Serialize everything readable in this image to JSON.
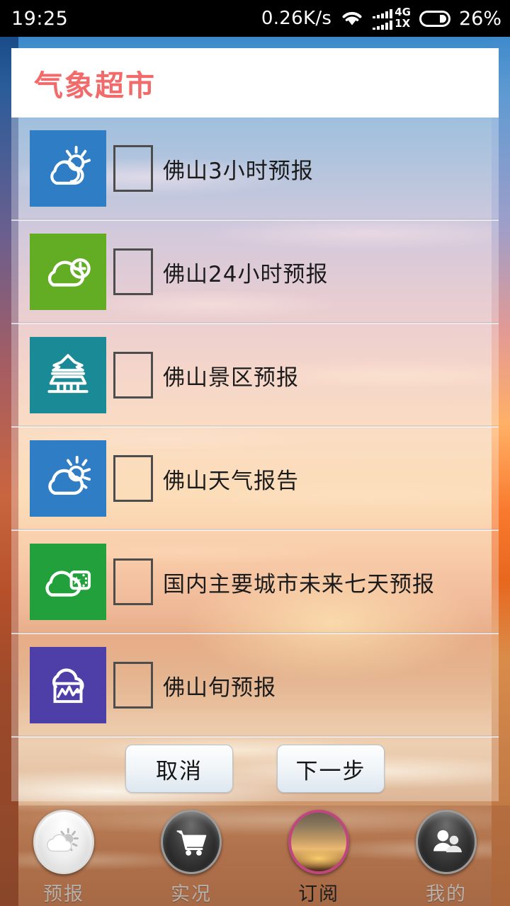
{
  "statusbar": {
    "clock": "19:25",
    "netspeed": "0.26K/s",
    "wifi_icon": "wifi-icon",
    "signal_icon": "signal-bars-icon",
    "net_type_primary": "4G",
    "net_type_secondary": "1X",
    "battery_icon": "battery-icon",
    "battery_percent": "26%"
  },
  "header": {
    "title": "气象超市"
  },
  "list": {
    "items": [
      {
        "label": "佛山3小时预报",
        "icon": "sun-behind-cloud-icon",
        "tile_color": "#2f7dc4",
        "checked": false
      },
      {
        "label": "佛山24小时预报",
        "icon": "cloud-clock-icon",
        "tile_color": "#62ad23",
        "checked": false
      },
      {
        "label": "佛山景区预报",
        "icon": "pagoda-icon",
        "tile_color": "#1a8a96",
        "checked": false
      },
      {
        "label": "佛山天气报告",
        "icon": "sun-cloud-rays-icon",
        "tile_color": "#2f7dc4",
        "checked": false
      },
      {
        "label": "国内主要城市未来七天预报",
        "icon": "cloud-china-flag-icon",
        "tile_color": "#22a03c",
        "checked": false
      },
      {
        "label": "佛山旬预报",
        "icon": "cloud-chart-icon",
        "tile_color": "#4e3fa8",
        "checked": false
      }
    ]
  },
  "actions": {
    "cancel_label": "取消",
    "next_label": "下一步"
  },
  "bottomnav": {
    "items": [
      {
        "label": "预报",
        "icon": "sun-cloud-icon",
        "active": false
      },
      {
        "label": "实况",
        "icon": "shopping-cart-icon",
        "active": false
      },
      {
        "label": "订阅",
        "icon": "sunset-photo-icon",
        "active": true
      },
      {
        "label": "我的",
        "icon": "people-icon",
        "active": false
      }
    ]
  },
  "colors": {
    "title_accent": "#f26b6b",
    "statusbar_bg": "#000000",
    "active_ring": "#c0467f"
  }
}
